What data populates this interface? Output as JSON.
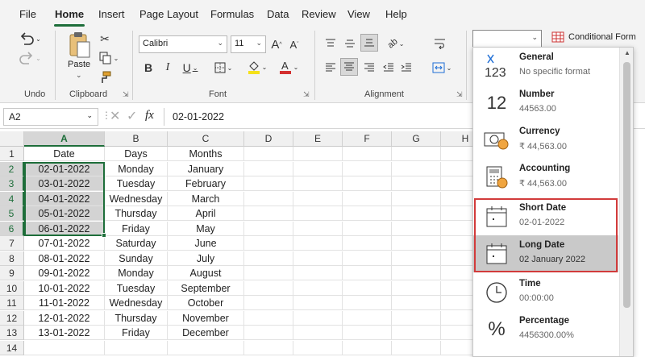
{
  "menu": {
    "items": [
      "File",
      "Home",
      "Insert",
      "Page Layout",
      "Formulas",
      "Data",
      "Review",
      "View",
      "Help"
    ],
    "active": "Home"
  },
  "ribbon": {
    "undo_label": "Undo",
    "clipboard_label": "Clipboard",
    "paste_label": "Paste",
    "font_label": "Font",
    "font_name": "Calibri",
    "font_size": "11",
    "alignment_label": "Alignment",
    "number_format_value": "",
    "conditional_formatting_label": "Conditional Form",
    "font_color": "#d32f2f",
    "highlight_color": "#f5e11a"
  },
  "formula_bar": {
    "name_box": "A2",
    "fx_label": "fx",
    "value": "02-01-2022"
  },
  "sheet": {
    "columns": [
      "A",
      "B",
      "C",
      "D",
      "E",
      "F",
      "G",
      "H"
    ],
    "selected_column": "A",
    "rows": [
      "1",
      "2",
      "3",
      "4",
      "5",
      "6",
      "7",
      "8",
      "9",
      "10",
      "11",
      "12",
      "13",
      "14"
    ],
    "selected_rows": [
      "2",
      "3",
      "4",
      "5",
      "6"
    ],
    "data": [
      [
        "Date",
        "Days",
        "Months"
      ],
      [
        "02-01-2022",
        "Monday",
        "January"
      ],
      [
        "03-01-2022",
        "Tuesday",
        "February"
      ],
      [
        "04-01-2022",
        "Wednesday",
        "March"
      ],
      [
        "05-01-2022",
        "Thursday",
        "April"
      ],
      [
        "06-01-2022",
        "Friday",
        "May"
      ],
      [
        "07-01-2022",
        "Saturday",
        "June"
      ],
      [
        "08-01-2022",
        "Sunday",
        "July"
      ],
      [
        "09-01-2022",
        "Monday",
        "August"
      ],
      [
        "10-01-2022",
        "Tuesday",
        "September"
      ],
      [
        "11-01-2022",
        "Wednesday",
        "October"
      ],
      [
        "12-01-2022",
        "Thursday",
        "November"
      ],
      [
        "13-01-2022",
        "Friday",
        "December"
      ],
      [
        "",
        "",
        ""
      ]
    ]
  },
  "number_formats": [
    {
      "name": "General",
      "example": "No specific format",
      "icon": "general-123-icon"
    },
    {
      "name": "Number",
      "example": "44563.00",
      "icon": "number-12-icon"
    },
    {
      "name": "Currency",
      "example": "₹ 44,563.00",
      "icon": "currency-icon"
    },
    {
      "name": "Accounting",
      "example": "₹ 44,563.00",
      "icon": "accounting-icon"
    },
    {
      "name": "Short Date",
      "example": "02-01-2022",
      "icon": "calendar-icon"
    },
    {
      "name": "Long Date",
      "example": "02 January 2022",
      "icon": "calendar-icon"
    },
    {
      "name": "Time",
      "example": "00:00:00",
      "icon": "clock-icon"
    },
    {
      "name": "Percentage",
      "example": "4456300.00%",
      "icon": "percent-icon"
    }
  ],
  "highlight_outline_color": "#d23b3b",
  "accent_color": "#1e6e3a"
}
